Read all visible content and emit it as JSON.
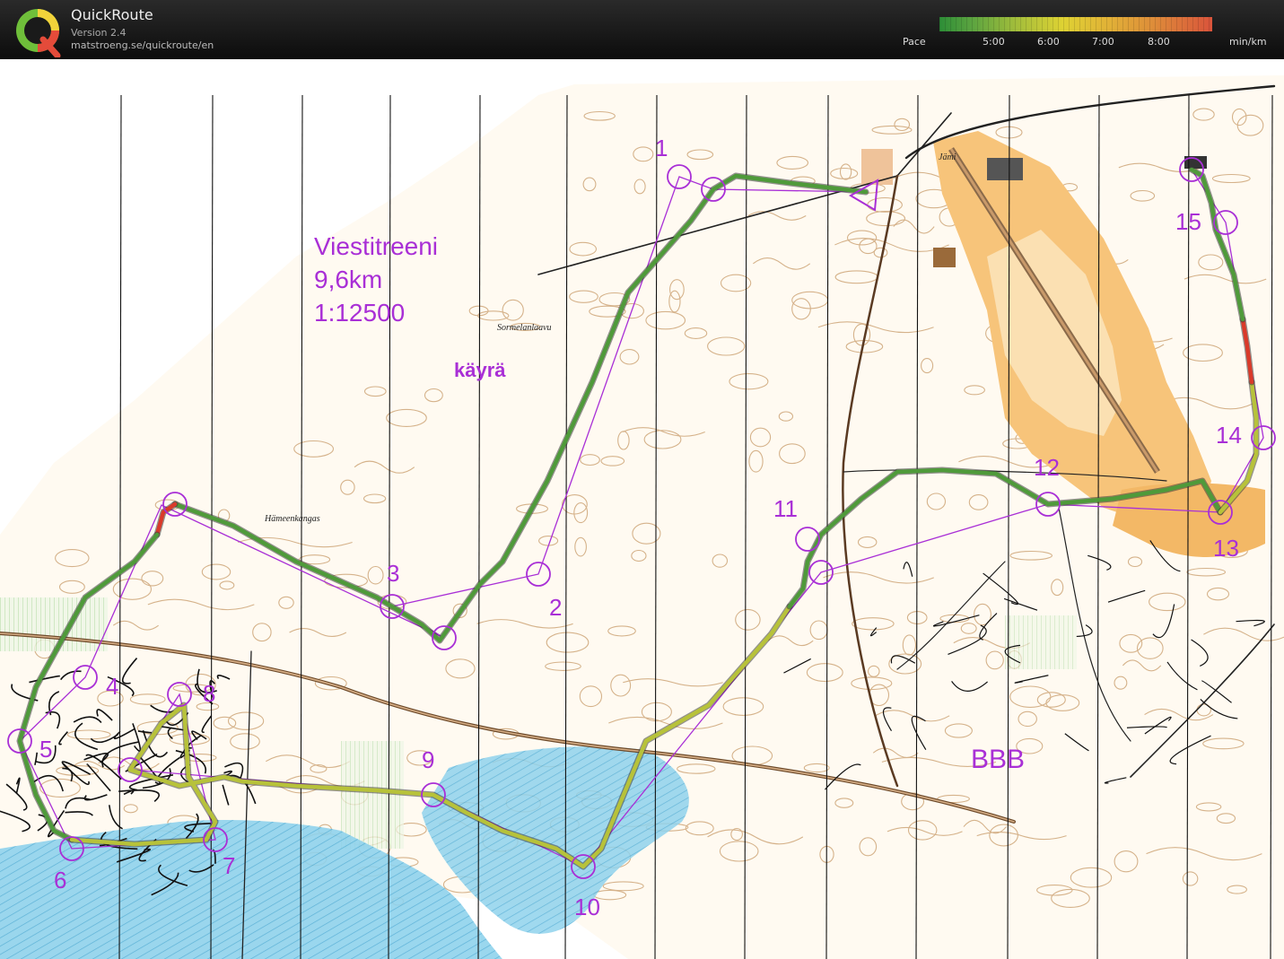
{
  "app": {
    "title": "QuickRoute",
    "version": "Version 2.4",
    "url": "matstroeng.se/quickroute/en"
  },
  "pace_legend": {
    "label": "Pace",
    "ticks": [
      "5:00",
      "6:00",
      "7:00",
      "8:00"
    ],
    "unit": "min/km"
  },
  "map": {
    "title_lines": [
      "Viestitreeni",
      "9,6km",
      "1:12500"
    ],
    "label_kayra": "käyrä",
    "label_bbb": "BBB",
    "place_names": {
      "sormelanlaavu": "Sormelanlaavu",
      "hameenkangas": "Hämeenkangas",
      "jami": "Jämi"
    },
    "controls": [
      "1",
      "2",
      "3",
      "4",
      "5",
      "6",
      "7",
      "8",
      "9",
      "10",
      "11",
      "12",
      "13",
      "14",
      "15"
    ],
    "colors": {
      "course": "#a92fd6",
      "route_fast": "#4f9a3a",
      "route_mid": "#b7c23a",
      "route_slow": "#d93a2a",
      "open_land": "#f6c67a",
      "water": "#7fc9e6",
      "contour": "#c08a54"
    }
  }
}
